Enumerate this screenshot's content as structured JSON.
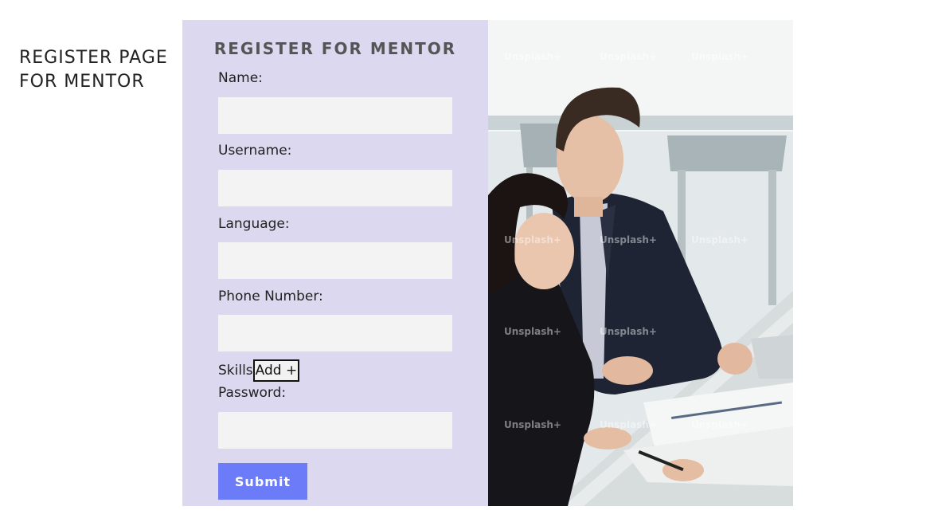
{
  "page": {
    "heading": "REGISTER PAGE FOR MENTOR"
  },
  "form": {
    "title": "REGISTER FOR MENTOR",
    "fields": [
      {
        "label": "Name:",
        "value": "",
        "placeholder": ""
      },
      {
        "label": "Username:",
        "value": "",
        "placeholder": ""
      },
      {
        "label": "Language:",
        "value": "",
        "placeholder": ""
      },
      {
        "label": "Phone Number:",
        "value": "",
        "placeholder": ""
      }
    ],
    "skills": {
      "label": "Skills",
      "add_button": "Add +"
    },
    "password": {
      "label": "Password:",
      "value": "",
      "placeholder": ""
    },
    "submit_label": "Submit"
  },
  "image": {
    "subject": "two people in a business meeting at an office table",
    "watermark_text": "Unsplash+"
  },
  "colors": {
    "form_background": "#dcd8ef",
    "input_background": "#f3f3f3",
    "submit_button": "#6c7cf8",
    "title_text": "#555555"
  }
}
